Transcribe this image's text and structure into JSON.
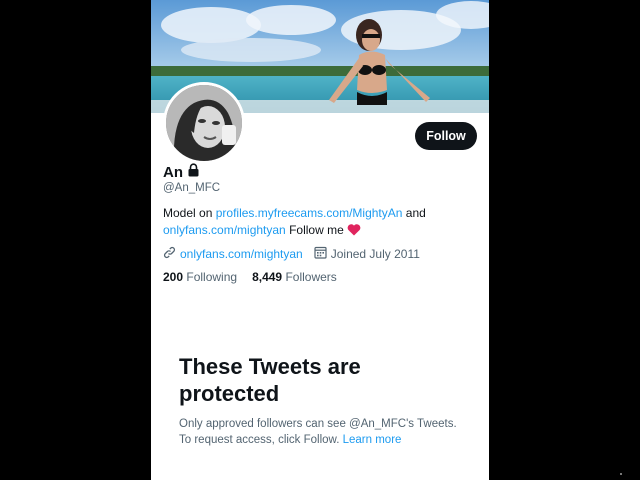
{
  "profile": {
    "name": "An",
    "handle": "@An_MFC",
    "follow_label": "Follow",
    "bio": {
      "prefix": "Model on",
      "link1": "profiles.myfreecams.com/MightyAn",
      "middle": "and",
      "link2": "onlyfans.com/mightyan",
      "suffix": "Follow me"
    },
    "website": "onlyfans.com/mightyan",
    "joined": "Joined July 2011",
    "following_count": "200",
    "following_label": "Following",
    "followers_count": "8,449",
    "followers_label": "Followers"
  },
  "protected": {
    "title": "These Tweets are protected",
    "line1": "Only approved followers can see @An_MFC's Tweets.",
    "line2_prefix": "To request access, click Follow.",
    "learn_more": "Learn more"
  },
  "colors": {
    "accent": "#1d9bf0",
    "button_bg": "#0f1419",
    "secondary_text": "#536471",
    "heart": "#e0245e"
  },
  "icons": [
    "lock-icon",
    "link-icon",
    "calendar-icon",
    "heart-icon"
  ]
}
